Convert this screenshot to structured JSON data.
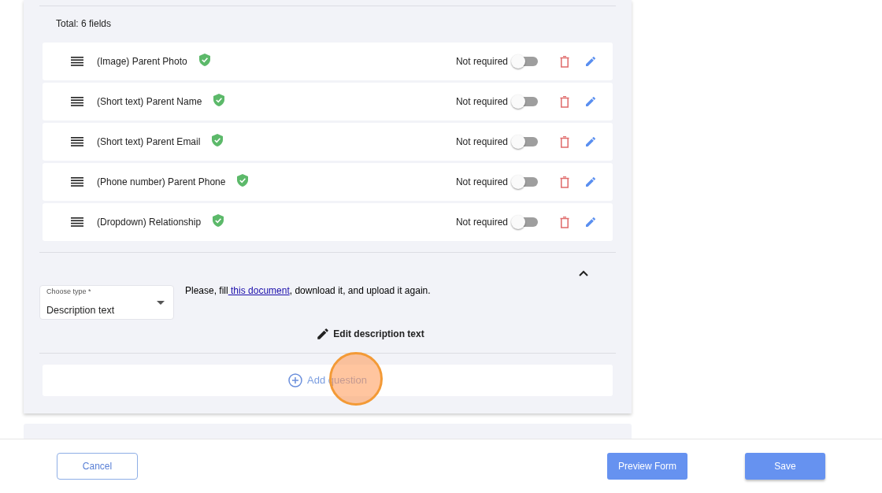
{
  "summary": "Total: 6 fields",
  "fields": [
    {
      "label": "(Image) Parent Photo",
      "verified": true,
      "required": false,
      "required_label": "Not required"
    },
    {
      "label": "(Short text) Parent Name",
      "verified": true,
      "required": false,
      "required_label": "Not required"
    },
    {
      "label": "(Short text) Parent Email",
      "verified": true,
      "required": false,
      "required_label": "Not required"
    },
    {
      "label": "(Phone number) Parent Phone",
      "verified": true,
      "required": false,
      "required_label": "Not required"
    },
    {
      "label": "(Dropdown) Relationship",
      "verified": true,
      "required": false,
      "required_label": "Not required"
    }
  ],
  "editor": {
    "expanded": true,
    "type_select": {
      "label": "Choose type *",
      "value": "Description text"
    },
    "description": {
      "before": "Please, fill",
      "link": " this document",
      "after": ", download it, and upload it again."
    },
    "edit_button": "Edit description text"
  },
  "add_question": "Add question",
  "footer": {
    "cancel": "Cancel",
    "preview": "Preview Form",
    "save": "Save"
  }
}
